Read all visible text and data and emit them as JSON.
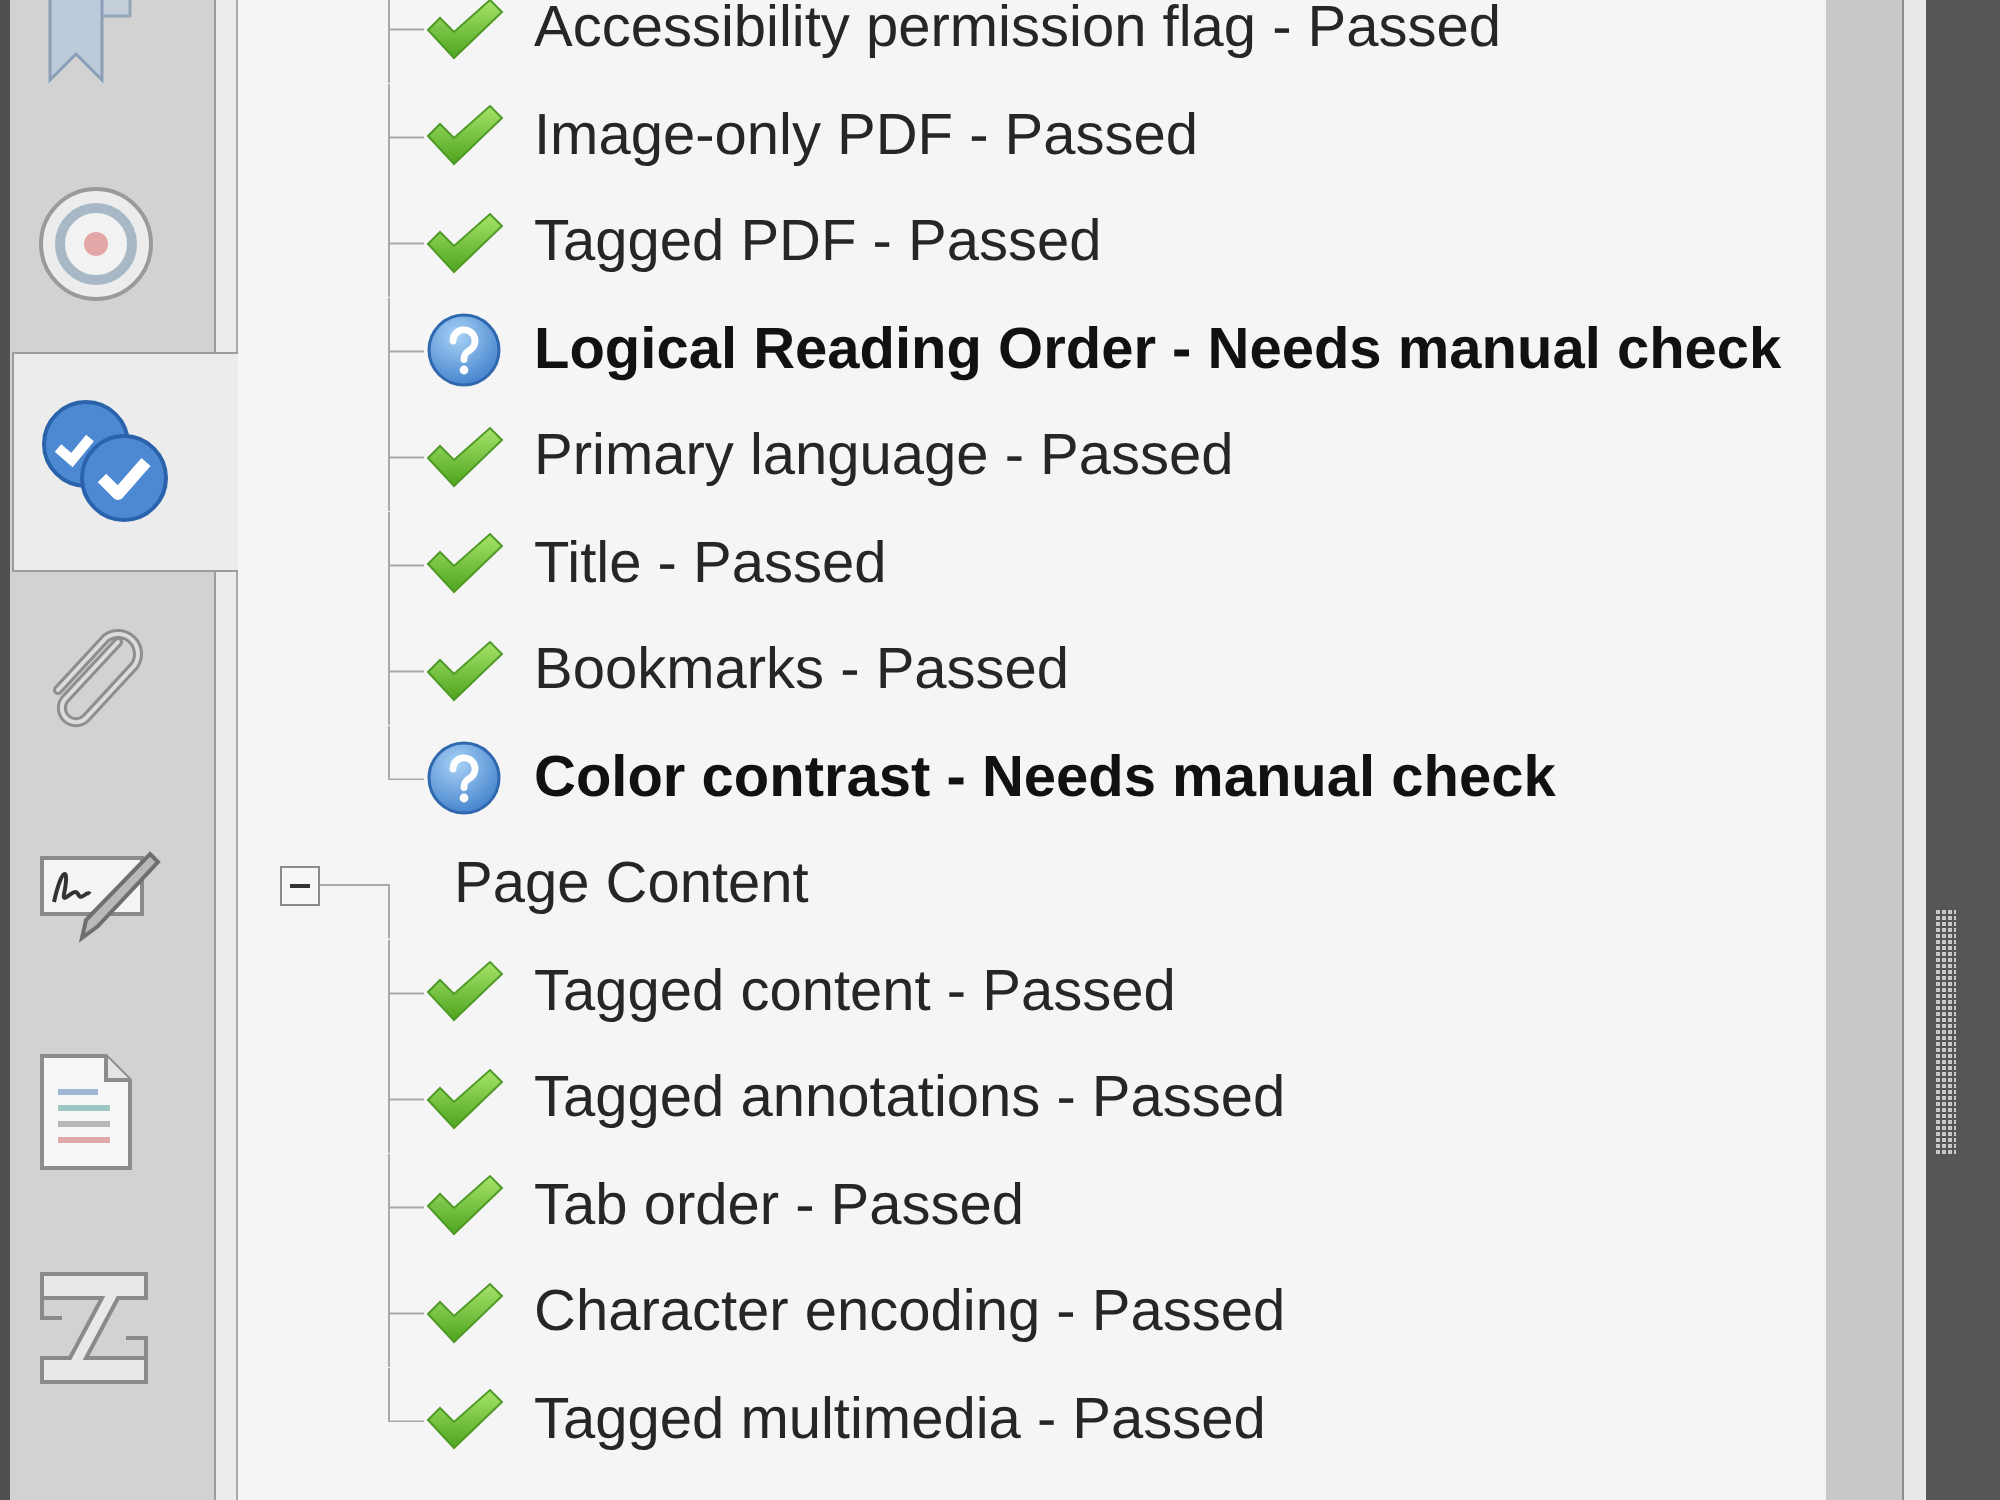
{
  "sidebar": {
    "tabs": [
      {
        "selected": false
      },
      {
        "selected": false
      },
      {
        "selected": true
      },
      {
        "selected": false
      },
      {
        "selected": false
      },
      {
        "selected": false
      },
      {
        "selected": false
      }
    ]
  },
  "tree": [
    {
      "children": [
        {
          "label": "Accessibility permission flag - Passed",
          "kind": "passed"
        },
        {
          "label": "Image-only PDF - Passed",
          "kind": "passed"
        },
        {
          "label": "Tagged PDF - Passed",
          "kind": "passed"
        },
        {
          "label": "Logical Reading Order - Needs manual check",
          "kind": "manual"
        },
        {
          "label": "Primary language - Passed",
          "kind": "passed"
        },
        {
          "label": "Title - Passed",
          "kind": "passed"
        },
        {
          "label": "Bookmarks - Passed",
          "kind": "passed"
        },
        {
          "label": "Color contrast - Needs manual check",
          "kind": "manual"
        }
      ]
    },
    {
      "label": "Page Content",
      "expanded": true,
      "children": [
        {
          "label": "Tagged content - Passed",
          "kind": "passed"
        },
        {
          "label": "Tagged annotations - Passed",
          "kind": "passed"
        },
        {
          "label": "Tab order - Passed",
          "kind": "passed"
        },
        {
          "label": "Character encoding - Passed",
          "kind": "passed"
        },
        {
          "label": "Tagged multimedia - Passed",
          "kind": "passed"
        }
      ]
    }
  ]
}
